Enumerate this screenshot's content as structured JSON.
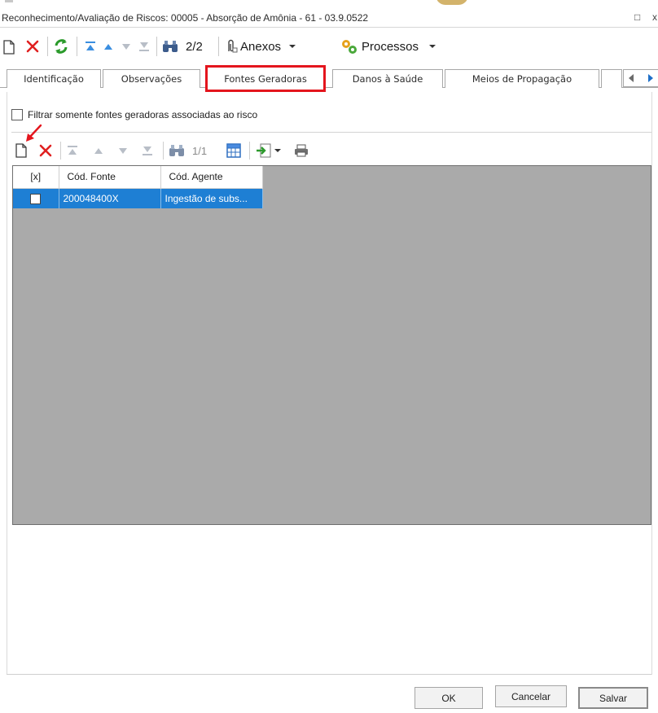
{
  "window": {
    "title": "Reconhecimento/Avaliação de Riscos: 00005 - Absorção de Amônia - 61 - 03.9.0522",
    "restore_glyph": "□",
    "close_glyph": "x"
  },
  "toolbar": {
    "record_counter": "2/2",
    "anexos_label": "Anexos",
    "processos_label": "Processos",
    "icons": [
      "new-icon",
      "delete-icon",
      "refresh-icon",
      "first-icon",
      "previous-icon",
      "next-icon",
      "last-icon",
      "binoculars-icon",
      "paperclip-icon",
      "gears-icon"
    ]
  },
  "tabs": [
    {
      "label": "Identificação"
    },
    {
      "label": "Observações"
    },
    {
      "label": "Fontes Geradoras",
      "active": true
    },
    {
      "label": "Danos à Saúde"
    },
    {
      "label": "Meios de Propagação"
    }
  ],
  "filter": {
    "label": "Filtrar somente fontes geradoras associadas ao risco",
    "checked": false
  },
  "subtoolbar": {
    "record_counter": "1/1"
  },
  "grid": {
    "columns": [
      "[x]",
      "Cód. Fonte",
      "Cód. Agente"
    ],
    "rows": [
      {
        "checked": false,
        "cod_fonte": "200048400X",
        "cod_agente": "Ingestão de subs..."
      }
    ]
  },
  "buttons": {
    "ok": "OK",
    "cancelar": "Cancelar",
    "salvar": "Salvar"
  },
  "colors": {
    "highlight_frame": "#e4151d",
    "selected_row": "#1e7fd4",
    "grid_background": "#aaaaaa"
  }
}
